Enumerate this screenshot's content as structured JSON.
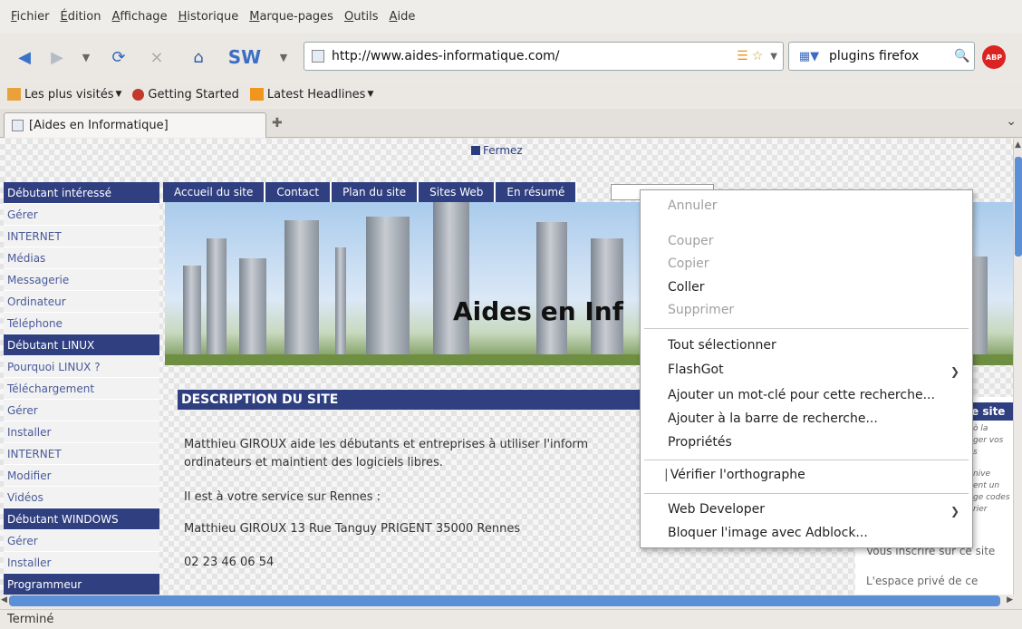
{
  "menubar": [
    "Fichier",
    "Édition",
    "Affichage",
    "Historique",
    "Marque-pages",
    "Outils",
    "Aide"
  ],
  "toolbar": {
    "back_icon": "arrow-left-icon",
    "forward_icon": "arrow-right-icon",
    "sw_label": "SW",
    "url": "http://www.aides-informatique.com/",
    "search_value": "plugins firefox",
    "abp_label": "ABP"
  },
  "bookmarks": [
    "Les plus visités",
    "Getting Started",
    "Latest Headlines"
  ],
  "tab": {
    "title": "[Aides en Informatique]"
  },
  "page": {
    "fermez": "Fermez",
    "sidebar": [
      {
        "label": "Débutant intéressé",
        "head": true
      },
      {
        "label": "Gérer",
        "head": false
      },
      {
        "label": "INTERNET",
        "head": false
      },
      {
        "label": "Médias",
        "head": false
      },
      {
        "label": "Messagerie",
        "head": false
      },
      {
        "label": "Ordinateur",
        "head": false
      },
      {
        "label": "Téléphone",
        "head": false
      },
      {
        "label": "Débutant LINUX",
        "head": true
      },
      {
        "label": "Pourquoi LINUX ?",
        "head": false
      },
      {
        "label": "Téléchargement",
        "head": false
      },
      {
        "label": "Gérer",
        "head": false
      },
      {
        "label": "Installer",
        "head": false
      },
      {
        "label": "INTERNET",
        "head": false
      },
      {
        "label": "Modifier",
        "head": false
      },
      {
        "label": "Vidéos",
        "head": false
      },
      {
        "label": "Débutant WINDOWS",
        "head": true
      },
      {
        "label": "Gérer",
        "head": false
      },
      {
        "label": "Installer",
        "head": false
      },
      {
        "label": "Programmeur",
        "head": true
      }
    ],
    "site_nav": [
      "Accueil du site",
      "Contact",
      "Plan du site",
      "Sites Web",
      "En résumé"
    ],
    "banner_title": "Aides en Inf",
    "desc_header": "DESCRIPTION DU SITE",
    "desc_line1": "Matthieu GIROUX aide les débutants et entreprises à utiliser l'inform",
    "desc_line2": "ordinateurs et maintient des logiciels libres.",
    "desc_line3": "Il est à votre service sur Rennes :",
    "desc_line4": "Matthieu GIROUX 13 Rue Tanguy PRIGENT 35000 Rennes",
    "desc_line5": "02 23 46 06 54",
    "right_header": "e site",
    "right_snips": [
      "ò la",
      "ger vos",
      "s",
      "nive",
      "ent un",
      "ge codes",
      "rier"
    ],
    "right_line1": "Vous inscrire sur ce site",
    "right_line2": "L'espace privé de ce"
  },
  "context_menu": {
    "undo": "Annuler",
    "cut": "Couper",
    "copy": "Copier",
    "paste": "Coller",
    "delete": "Supprimer",
    "select_all": "Tout sélectionner",
    "flashgot": "FlashGot",
    "add_keyword": "Ajouter un mot-clé pour cette recherche...",
    "add_searchbar": "Ajouter à la barre de recherche...",
    "properties": "Propriétés",
    "spellcheck": "Vérifier l'orthographe",
    "webdev": "Web Developer",
    "adblock": "Bloquer l'image avec Adblock..."
  },
  "status": "Terminé"
}
